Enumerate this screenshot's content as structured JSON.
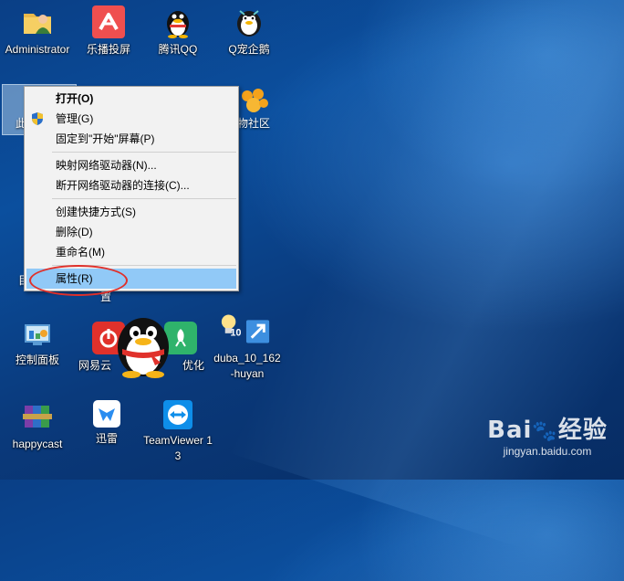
{
  "desktop": {
    "icons": [
      {
        "id": "administrator",
        "label": "Administrator",
        "icon": "user-folder-icon"
      },
      {
        "id": "lebo",
        "label": "乐播投屏",
        "icon": "lebo-cast-icon"
      },
      {
        "id": "qq",
        "label": "腾讯QQ",
        "icon": "qq-penguin-icon"
      },
      {
        "id": "qpet",
        "label": "Q宠企鹅",
        "icon": "qq-pet-icon"
      },
      {
        "id": "this-pc",
        "label": "此",
        "icon": "computer-icon"
      },
      {
        "id": "pet-community",
        "label": "物社区",
        "icon": "paw-icon"
      },
      {
        "id": "control-panel",
        "label": "控制面板",
        "icon": "control-panel-icon"
      },
      {
        "id": "netease",
        "label": "网易云",
        "icon": "netease-music-icon"
      },
      {
        "id": "optimize",
        "label": "优化",
        "icon": "rocket-icon"
      },
      {
        "id": "duba",
        "label": "duba_10_162-huyan",
        "icon": "duba-installer-icon"
      },
      {
        "id": "happycast",
        "label": "happycast",
        "icon": "winrar-icon"
      },
      {
        "id": "xunlei",
        "label": "迅雷",
        "icon": "xunlei-bird-icon"
      },
      {
        "id": "teamviewer",
        "label": "TeamViewer 13",
        "icon": "teamviewer-icon"
      }
    ],
    "partial_labels": {
      "left_mid": "目",
      "under_menu": "置"
    }
  },
  "context_menu": {
    "items": [
      {
        "label": "打开(O)",
        "bold": true
      },
      {
        "label": "管理(G)",
        "icon": "uac-shield-icon"
      },
      {
        "label": "固定到\"开始\"屏幕(P)"
      },
      {
        "separator": true
      },
      {
        "label": "映射网络驱动器(N)..."
      },
      {
        "label": "断开网络驱动器的连接(C)..."
      },
      {
        "separator": true
      },
      {
        "label": "创建快捷方式(S)"
      },
      {
        "label": "删除(D)"
      },
      {
        "label": "重命名(M)"
      },
      {
        "separator": true
      },
      {
        "label": "属性(R)",
        "highlighted": true
      }
    ]
  },
  "watermark": {
    "brand_left": "Bai",
    "brand_right": "经验",
    "url": "jingyan.baidu.com"
  },
  "colors": {
    "menu_highlight": "#91c9f7",
    "ring": "#e0302a",
    "desktop": "#0b4f9e"
  }
}
